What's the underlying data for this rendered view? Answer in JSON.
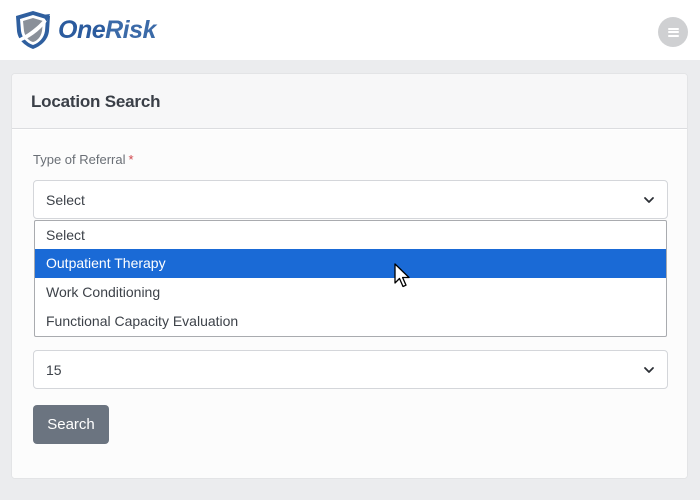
{
  "header": {
    "brand_part1": "One",
    "brand_part2": "Risk",
    "logo_icon": "shield-logo-icon",
    "menu_icon": "hamburger-menu-icon"
  },
  "card": {
    "title": "Location Search"
  },
  "form": {
    "referral_label": "Type of Referral",
    "required_marker": "*",
    "referral_selected": "Select",
    "referral_options": [
      "Select",
      "Outpatient Therapy",
      "Work Conditioning",
      "Functional Capacity Evaluation"
    ],
    "highlighted_option_index": 1,
    "radius_selected": "15",
    "search_label": "Search"
  },
  "colors": {
    "brand_blue": "#2b5b9e",
    "highlight": "#1a6ad6",
    "button_gray": "#6b7480",
    "required_red": "#d0454c"
  }
}
